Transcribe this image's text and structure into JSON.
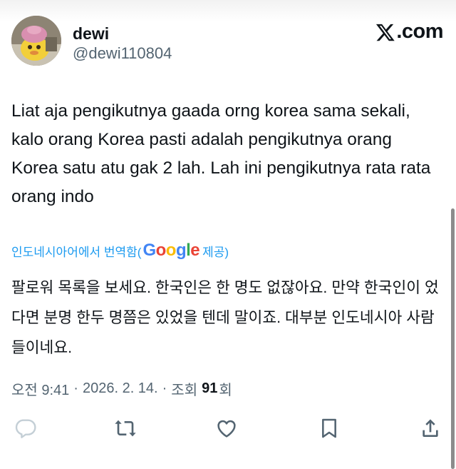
{
  "tweet": {
    "author_name": "dewi",
    "author_handle": "@dewi110804",
    "site_label": "X.com",
    "text": "Liat aja pengikutnya gaada orng korea sama sekali, kalo orang Korea pasti adalah pengikutnya orang Korea satu atu gak 2 lah. Lah ini pengikutnya rata rata orang indo",
    "translation_label": "인도네시아어에서 번역함(",
    "translation_provider": "Google",
    "translation_suffix": " 제공)",
    "translated_text": "팔로워 목록을 보세요. 한국인은 한 명도 없잖아요. 만약 한국인이 었다면 분명 한두 명쯤은 있었을 텐데 말이죠. 대부분 인도네시아 사람들이네요.",
    "time": "오전 9:41",
    "separator": "·",
    "date": "2026. 2. 14.",
    "views_label": "조회",
    "views_count": "91",
    "views_suffix": "회"
  },
  "actions": [
    "reply-icon",
    "retweet-icon",
    "like-icon",
    "bookmark-icon",
    "share-icon"
  ],
  "colors": {
    "text": "#0f1419",
    "secondary": "#536471",
    "link": "#1d9bf0"
  }
}
